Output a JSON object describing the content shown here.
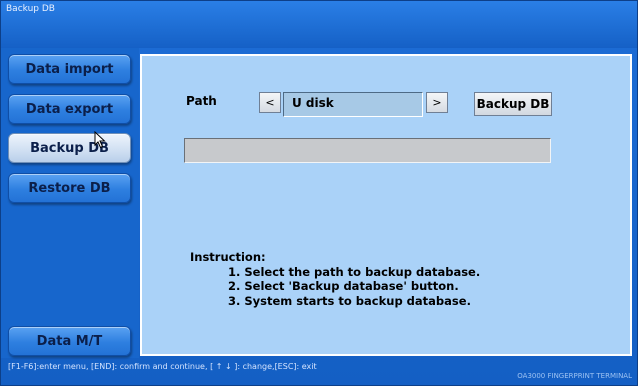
{
  "window": {
    "title": "Backup DB",
    "brand": "OA3000 FINGERPRINT TERMINAL"
  },
  "sidebar": {
    "items": [
      {
        "label": "Data import",
        "active": false
      },
      {
        "label": "Data export",
        "active": false
      },
      {
        "label": "Backup DB",
        "active": true
      },
      {
        "label": "Restore DB",
        "active": false
      },
      {
        "label": "Data M/T",
        "active": false
      }
    ]
  },
  "form": {
    "path_label": "Path",
    "prev_label": "<",
    "next_label": ">",
    "path_value": "U disk",
    "backup_button": "Backup DB",
    "progress_percent": 0
  },
  "instruction": {
    "heading": "Instruction:",
    "steps": [
      "1. Select the path to backup database.",
      "2. Select 'Backup database' button.",
      "3. System starts to backup database."
    ]
  },
  "status_bar": "[F1-F6]:enter menu, [END]: confirm and continue, [ ↑ ↓ ]: change,[ESC]: exit"
}
